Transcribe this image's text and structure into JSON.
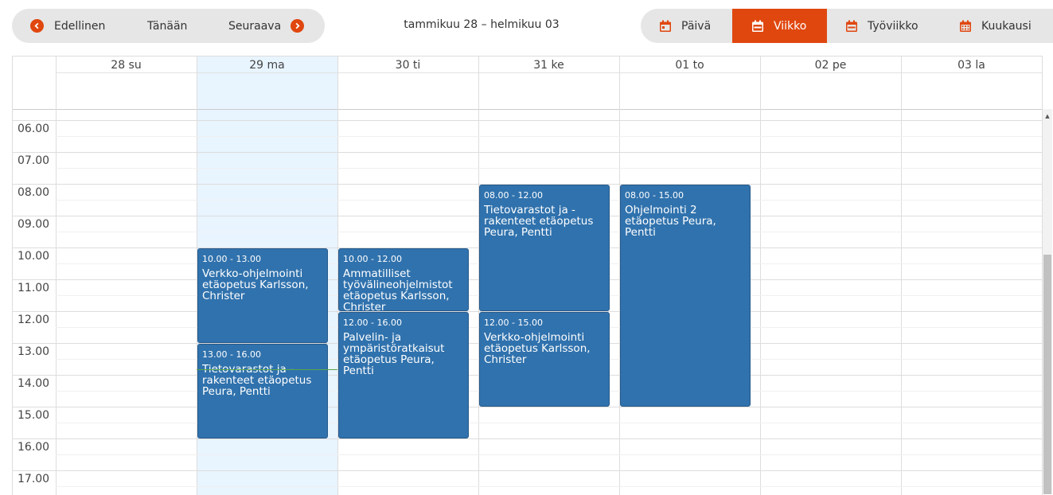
{
  "toolbar": {
    "prev_label": "Edellinen",
    "today_label": "Tänään",
    "next_label": "Seuraava",
    "range_title": "tammikuu 28 – helmikuu 03",
    "views": [
      {
        "label": "Päivä",
        "icon": "calendar-day-icon",
        "active": false
      },
      {
        "label": "Viikko",
        "icon": "calendar-week-icon",
        "active": true
      },
      {
        "label": "Työviikko",
        "icon": "calendar-workweek-icon",
        "active": false
      },
      {
        "label": "Kuukausi",
        "icon": "calendar-month-icon",
        "active": false
      }
    ],
    "accent_color": "#e0470f"
  },
  "calendar": {
    "days": [
      "28 su",
      "29 ma",
      "30 ti",
      "31 ke",
      "01 to",
      "02 pe",
      "03 la"
    ],
    "today": "29 ma",
    "hours": [
      "06.00",
      "07.00",
      "08.00",
      "09.00",
      "10.00",
      "11.00",
      "12.00",
      "13.00",
      "14.00",
      "15.00",
      "16.00",
      "17.00"
    ],
    "event_color": "#3072ad",
    "events": [
      {
        "time": "10.00 - 13.00",
        "title": "Verkko-ohjelmointi etäopetus Karlsson, Christer"
      },
      {
        "time": "13.00 - 16.00",
        "title": "Tietovarastot ja -rakenteet etäopetus Peura, Pentti"
      },
      {
        "time": "10.00 - 12.00",
        "title": "Ammatilliset työvälineohjelmistot etäopetus Karlsson, Christer"
      },
      {
        "time": "12.00 - 16.00",
        "title": "Palvelin- ja ympäristöratkaisut etäopetus Peura, Pentti"
      },
      {
        "time": "08.00 - 12.00",
        "title": "Tietovarastot ja -rakenteet etäopetus Peura, Pentti"
      },
      {
        "time": "12.00 - 15.00",
        "title": "Verkko-ohjelmointi etäopetus Karlsson, Christer"
      },
      {
        "time": "08.00 - 15.00",
        "title": "Ohjelmointi 2 etäopetus Peura, Pentti"
      }
    ]
  }
}
